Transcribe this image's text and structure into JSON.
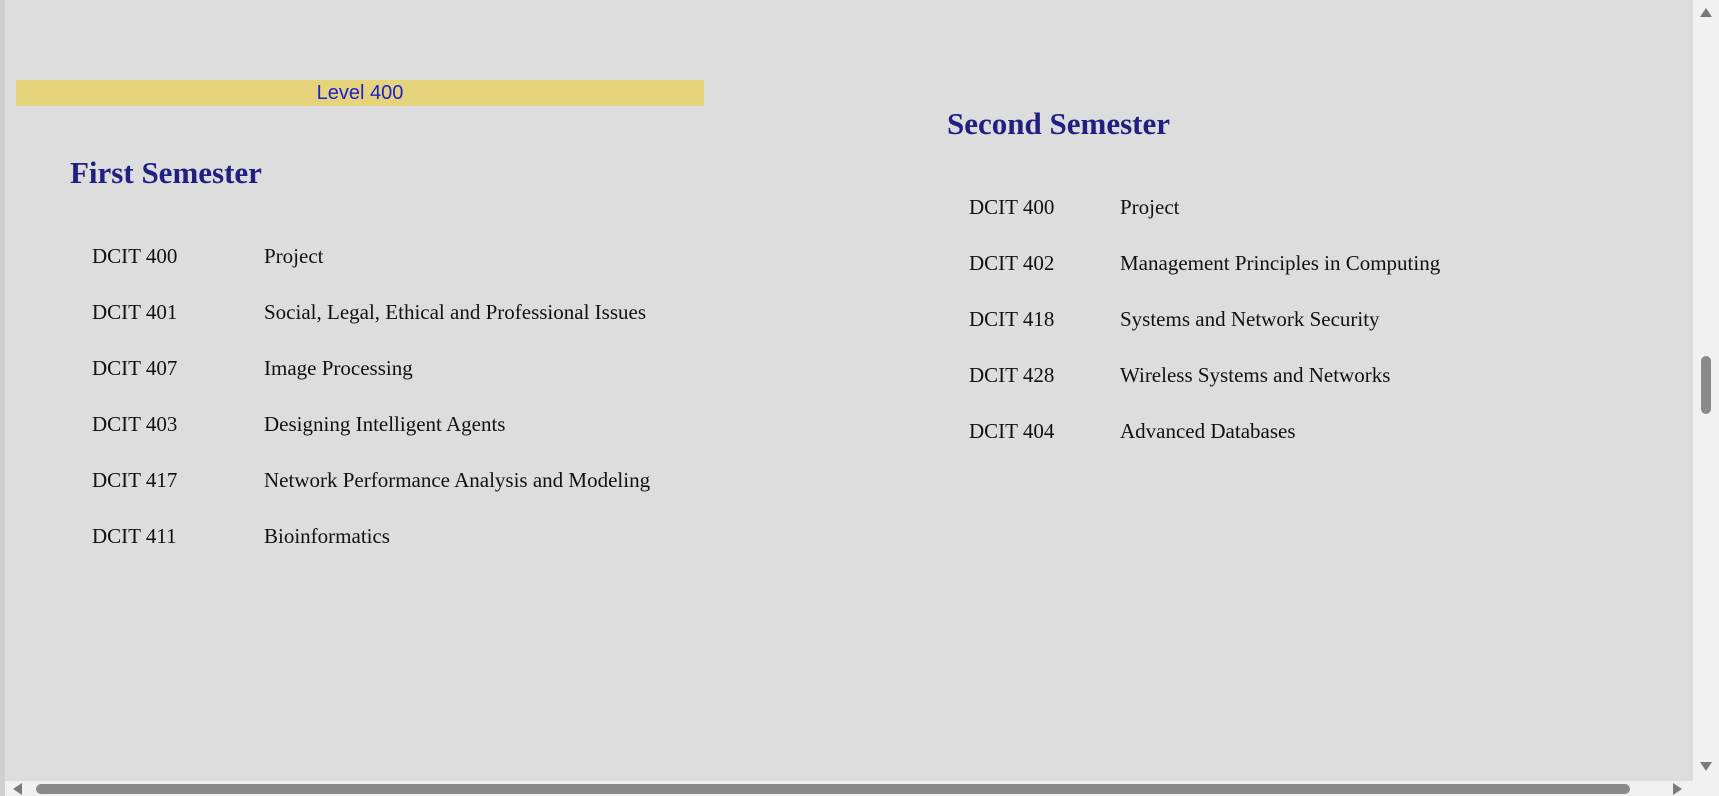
{
  "level": {
    "label": "Level 400"
  },
  "first_semester": {
    "title": "First Semester",
    "courses": [
      {
        "code": "DCIT 400",
        "name": "Project"
      },
      {
        "code": "DCIT 401",
        "name": "Social, Legal, Ethical and Professional Issues"
      },
      {
        "code": "DCIT 407",
        "name": "Image Processing"
      },
      {
        "code": "DCIT 403",
        "name": "Designing Intelligent Agents"
      },
      {
        "code": "DCIT 417",
        "name": "Network Performance Analysis and Modeling"
      },
      {
        "code": "DCIT 411",
        "name": "Bioinformatics"
      }
    ]
  },
  "second_semester": {
    "title": "Second Semester",
    "courses": [
      {
        "code": "DCIT 400",
        "name": "Project"
      },
      {
        "code": "DCIT 402",
        "name": "Management Principles in Computing"
      },
      {
        "code": "DCIT 418",
        "name": "Systems and Network Security"
      },
      {
        "code": "DCIT 428",
        "name": "Wireless Systems and Networks"
      },
      {
        "code": "DCIT 404",
        "name": "Advanced Databases"
      }
    ]
  },
  "colors": {
    "background": "#dddddd",
    "level_bar": "#e5d47c",
    "level_text": "#1d1fd0",
    "heading": "#1f2081"
  },
  "scrollbars": {
    "vertical_icons": [
      "scroll-up-icon",
      "scroll-down-icon"
    ],
    "horizontal_icons": [
      "scroll-left-icon",
      "scroll-right-icon"
    ]
  }
}
